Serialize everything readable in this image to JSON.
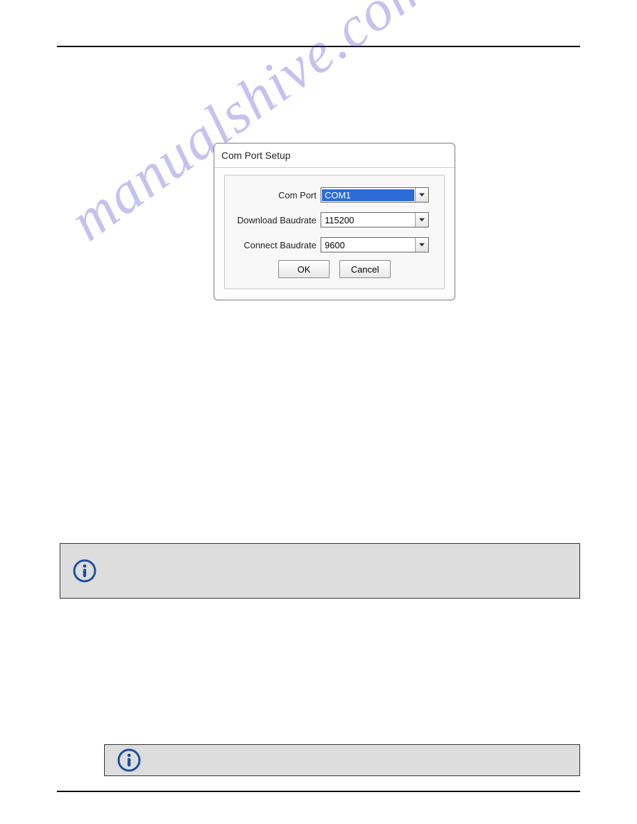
{
  "dialog": {
    "title": "Com Port Setup",
    "fields": {
      "com_port": {
        "label": "Com Port",
        "value": "COM1"
      },
      "download": {
        "label": "Download Baudrate",
        "value": "115200"
      },
      "connect": {
        "label": "Connect Baudrate",
        "value": "9600"
      }
    },
    "buttons": {
      "ok": "OK",
      "cancel": "Cancel"
    }
  },
  "watermark": "manualshive.com"
}
